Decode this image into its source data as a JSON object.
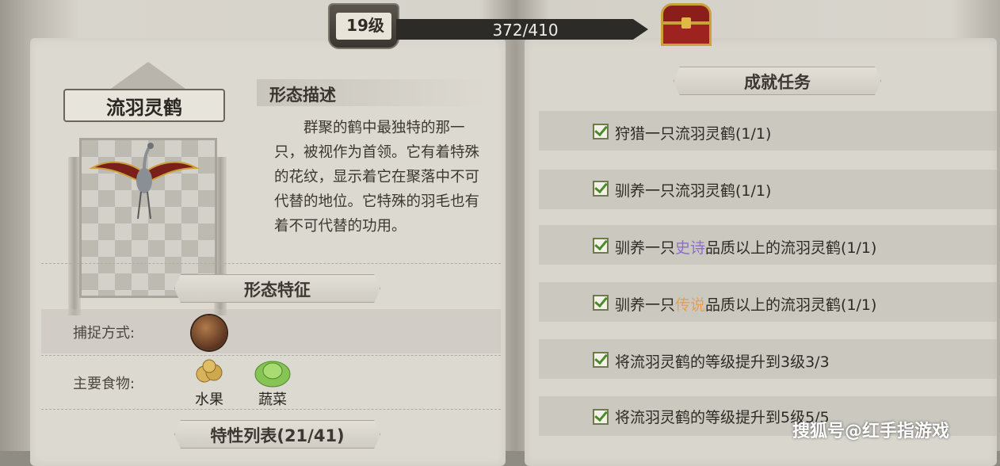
{
  "header": {
    "level": "19级",
    "xp": "372/410"
  },
  "creature": {
    "name": "流羽灵鹤"
  },
  "description": {
    "title": "形态描述",
    "body": "群聚的鹤中最独特的那一只，被视作为首领。它有着特殊的花纹，显示着它在聚落中不可代替的地位。它特殊的羽毛也有着不可代替的功用。"
  },
  "features": {
    "title": "形态特征",
    "capture_label": "捕捉方式:",
    "food_label": "主要食物:",
    "foods": [
      "水果",
      "蔬菜"
    ]
  },
  "traits": {
    "title": "特性列表(21/41)"
  },
  "achievements": {
    "title": "成就任务",
    "quests": [
      {
        "prefix": "狩猎一只流羽灵鹤(1/1)",
        "highlight": "",
        "suffix": ""
      },
      {
        "prefix": "驯养一只流羽灵鹤(1/1)",
        "highlight": "",
        "suffix": ""
      },
      {
        "prefix": "驯养一只",
        "highlight": "史诗",
        "suffix": "品质以上的流羽灵鹤(1/1)"
      },
      {
        "prefix": "驯养一只",
        "highlight": "传说",
        "suffix": "品质以上的流羽灵鹤(1/1)"
      },
      {
        "prefix": "将流羽灵鹤的等级提升到3级3/3",
        "highlight": "",
        "suffix": ""
      },
      {
        "prefix": "将流羽灵鹤的等级提升到5级5/5",
        "highlight": "",
        "suffix": ""
      }
    ]
  },
  "watermark": "搜狐号@红手指游戏",
  "colors": {
    "check_green": "#4c8a2a",
    "epic_purple": "#8f6dd0",
    "legend_orange": "#e8a050",
    "xp_bar": "#2d2b28"
  }
}
